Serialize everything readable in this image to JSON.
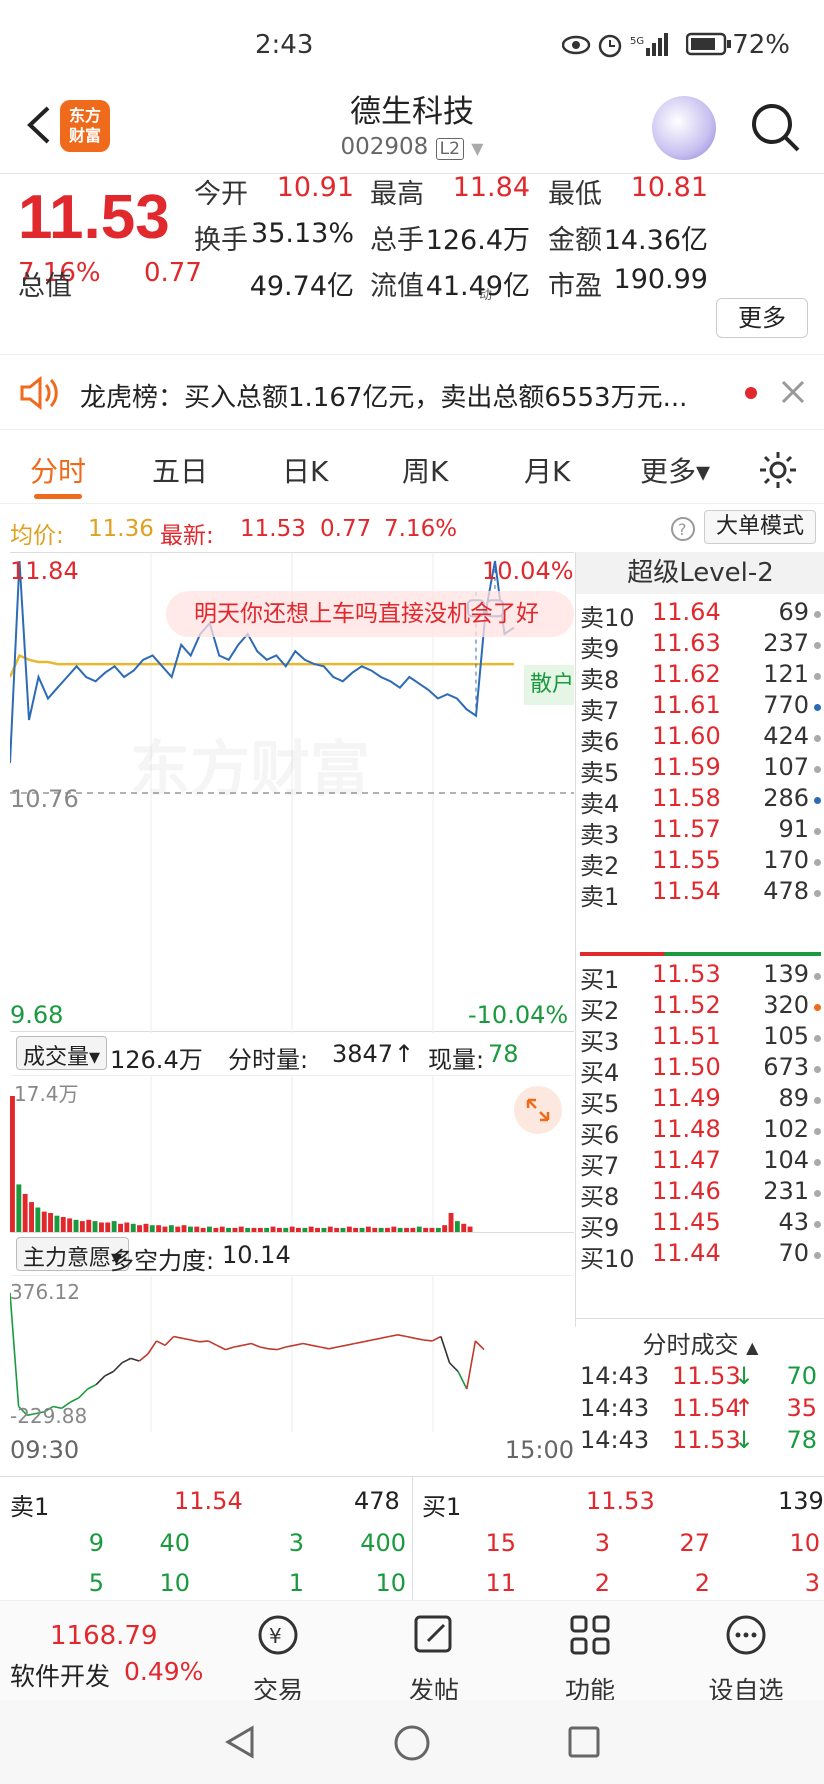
{
  "status": {
    "time": "2:43",
    "battery": "72%"
  },
  "header": {
    "title": "德生科技",
    "code": "002908",
    "level": "L2",
    "logo_lines": [
      "东方",
      "财富"
    ]
  },
  "quote": {
    "price": "11.53",
    "change_pct": "7.16%",
    "change": "0.77",
    "fields": [
      {
        "label": "今开",
        "value": "10.91",
        "color": "red"
      },
      {
        "label": "最高",
        "value": "11.84",
        "color": "red"
      },
      {
        "label": "最低",
        "value": "10.81",
        "color": "red"
      },
      {
        "label": "换手",
        "value": "35.13%",
        "color": "black"
      },
      {
        "label": "总手",
        "value": "126.4万",
        "color": "black"
      },
      {
        "label": "金额",
        "value": "14.36亿",
        "color": "black"
      },
      {
        "label": "总值",
        "value": "49.74亿",
        "color": "black"
      },
      {
        "label": "流值",
        "value": "41.49亿",
        "color": "black"
      },
      {
        "label": "市盈",
        "value": "190.99",
        "color": "black"
      }
    ],
    "pe_superscript": "动",
    "more_label": "更多"
  },
  "notice": {
    "text": "龙虎榜：买入总额1.167亿元，卖出总额6553万元..."
  },
  "tabs": [
    {
      "label": "分时",
      "active": true
    },
    {
      "label": "五日"
    },
    {
      "label": "日K"
    },
    {
      "label": "周K"
    },
    {
      "label": "月K"
    },
    {
      "label": "更多▾"
    }
  ],
  "infoline": {
    "avg_label": "均价:",
    "avg": "11.36",
    "last_label": "最新:",
    "last": "11.53",
    "chg": "0.77",
    "pct": "7.16%",
    "bigorder_label": "大单模式"
  },
  "chart": {
    "high_label": "11.84",
    "high_pct": "10.04%",
    "mid_label": "10.76",
    "low_label": "9.68",
    "low_pct": "-10.04%",
    "watermark": "东方财富",
    "danmaku": "明天你还想上车吗直接没机会了好",
    "tag_label": "散户",
    "colors": {
      "price": "#2d6bb5",
      "avg": "#e8b830",
      "up": "#e0282d",
      "down": "#1a9a3e"
    }
  },
  "chart_data": {
    "type": "line",
    "x_range": [
      "09:30",
      "15:00"
    ],
    "ylim": [
      9.68,
      11.84
    ],
    "series": [
      {
        "name": "",
        "values": [
          10.9,
          11.84,
          11.1,
          11.3,
          11.2,
          11.25,
          11.3,
          11.35,
          11.3,
          11.28,
          11.32,
          11.35,
          11.3,
          11.33,
          11.38,
          11.4,
          11.35,
          11.3,
          11.45,
          11.4,
          11.5,
          11.55,
          11.4,
          11.38,
          11.45,
          11.5,
          11.42,
          11.38,
          11.4,
          11.35,
          11.42,
          11.38,
          11.36,
          11.35,
          11.3,
          11.28,
          11.32,
          11.35,
          11.33,
          11.3,
          11.28,
          11.25,
          11.3,
          11.27,
          11.24,
          11.2,
          11.22,
          11.2,
          11.15,
          11.12,
          11.6,
          11.84,
          11.5,
          11.53
        ]
      },
      {
        "name": "",
        "values": [
          11.3,
          11.4,
          11.38,
          11.37,
          11.37,
          11.36,
          11.36,
          11.36,
          11.36,
          11.36,
          11.36,
          11.36,
          11.36,
          11.36,
          11.36,
          11.36,
          11.36,
          11.36,
          11.36,
          11.36,
          11.36,
          11.36,
          11.36,
          11.36,
          11.36,
          11.36,
          11.36,
          11.36,
          11.36,
          11.36,
          11.36,
          11.36,
          11.36,
          11.36,
          11.36,
          11.36,
          11.36,
          11.36,
          11.36,
          11.36,
          11.36,
          11.36,
          11.36,
          11.36,
          11.36,
          11.36,
          11.36,
          11.36,
          11.36,
          11.36,
          11.36,
          11.36,
          11.36,
          11.36
        ]
      }
    ]
  },
  "volume": {
    "label": "成交量▾",
    "total": "126.4万",
    "tick_label": "分时量:",
    "tick": "3847",
    "now_label": "现量:",
    "now": "78",
    "max_label": "17.4万",
    "bars": [
      100,
      35,
      28,
      22,
      18,
      15,
      14,
      12,
      11,
      10,
      9,
      8,
      9,
      8,
      7,
      7,
      8,
      6,
      7,
      6,
      5,
      6,
      5,
      5,
      4,
      5,
      4,
      5,
      4,
      4,
      3,
      4,
      3,
      4,
      3,
      3,
      4,
      3,
      3,
      3,
      3,
      4,
      3,
      3,
      4,
      3,
      3,
      4,
      3,
      3,
      4,
      3,
      3,
      4,
      3,
      3,
      4,
      3,
      3,
      3,
      4,
      3,
      3,
      3,
      4,
      3,
      3,
      3,
      5,
      14,
      8,
      6,
      4
    ]
  },
  "moneyflow": {
    "label": "主力意愿▾",
    "strength_label": "多空力度:",
    "strength": "10.14",
    "top_label": "376.12",
    "bottom_label": "-229.88"
  },
  "times": {
    "start": "09:30",
    "end": "15:00"
  },
  "book": {
    "title": "超级Level-2",
    "asks": [
      {
        "label": "卖10",
        "price": "11.64",
        "vol": "69"
      },
      {
        "label": "卖9",
        "price": "11.63",
        "vol": "237"
      },
      {
        "label": "卖8",
        "price": "11.62",
        "vol": "121"
      },
      {
        "label": "卖7",
        "price": "11.61",
        "vol": "770"
      },
      {
        "label": "卖6",
        "price": "11.60",
        "vol": "424"
      },
      {
        "label": "卖5",
        "price": "11.59",
        "vol": "107"
      },
      {
        "label": "卖4",
        "price": "11.58",
        "vol": "286"
      },
      {
        "label": "卖3",
        "price": "11.57",
        "vol": "91"
      },
      {
        "label": "卖2",
        "price": "11.55",
        "vol": "170"
      },
      {
        "label": "卖1",
        "price": "11.54",
        "vol": "478"
      }
    ],
    "bids": [
      {
        "label": "买1",
        "price": "11.53",
        "vol": "139"
      },
      {
        "label": "买2",
        "price": "11.52",
        "vol": "320"
      },
      {
        "label": "买3",
        "price": "11.51",
        "vol": "105"
      },
      {
        "label": "买4",
        "price": "11.50",
        "vol": "673"
      },
      {
        "label": "买5",
        "price": "11.49",
        "vol": "89"
      },
      {
        "label": "买6",
        "price": "11.48",
        "vol": "102"
      },
      {
        "label": "买7",
        "price": "11.47",
        "vol": "104"
      },
      {
        "label": "买8",
        "price": "11.46",
        "vol": "231"
      },
      {
        "label": "买9",
        "price": "11.45",
        "vol": "43"
      },
      {
        "label": "买10",
        "price": "11.44",
        "vol": "70"
      }
    ],
    "ticks_title": "分时成交",
    "ticks": [
      {
        "time": "14:43",
        "price": "11.53",
        "dir": "↓",
        "vol": "70"
      },
      {
        "time": "14:43",
        "price": "11.54",
        "dir": "↑",
        "vol": "35"
      },
      {
        "time": "14:43",
        "price": "11.53",
        "dir": "↓",
        "vol": "78"
      }
    ]
  },
  "queue": {
    "sell_label": "卖1",
    "sell_price": "11.54",
    "sell_vol": "478",
    "buy_label": "买1",
    "buy_price": "11.53",
    "buy_vol": "139",
    "sell_rows": [
      [
        "9",
        "40",
        "3",
        "400"
      ],
      [
        "5",
        "10",
        "1",
        "10"
      ]
    ],
    "buy_rows": [
      [
        "15",
        "3",
        "27",
        "10"
      ],
      [
        "11",
        "2",
        "2",
        "3"
      ]
    ]
  },
  "bottomnav": {
    "index_value": "1168.79",
    "index_name": "软件开发",
    "index_pct": "0.49%",
    "items": [
      "交易",
      "发帖",
      "功能",
      "设自选"
    ]
  }
}
